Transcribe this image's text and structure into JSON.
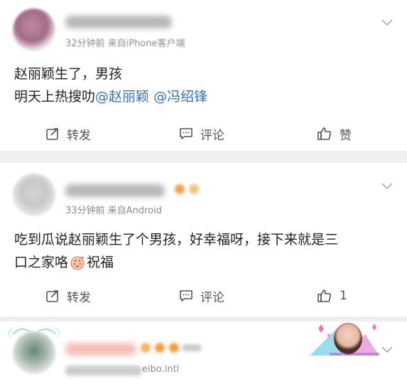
{
  "posts": [
    {
      "meta": "32分钟前  来自iPhone客户端",
      "line1": "赵丽颖生了，男孩",
      "line2_prefix": "明天上热搜叻",
      "mention1": "@赵丽颖",
      "mention2": "@冯绍锋",
      "repost_label": "转发",
      "comment_label": "评论",
      "like_label": "赞"
    },
    {
      "meta": "33分钟前  来自Android",
      "line1": "吃到瓜说赵丽颖生了个男孩，好幸福呀，接下来就是三",
      "line2_prefix": "口之家咯",
      "line2_suffix": "祝福",
      "repost_label": "转发",
      "comment_label": "评论",
      "like_count": "1"
    },
    {
      "meta_suffix": "eibo.intl"
    }
  ],
  "icons": {
    "repost": "repost-icon",
    "comment": "comment-icon",
    "like": "thumbs-up-icon",
    "menu": "chevron-down-icon",
    "emoji": "blush-emoji-icon"
  },
  "colors": {
    "mention": "#3a6fb0",
    "background": "#efefef",
    "card": "#ffffff",
    "text": "#222222",
    "meta": "#8a8a8a"
  }
}
